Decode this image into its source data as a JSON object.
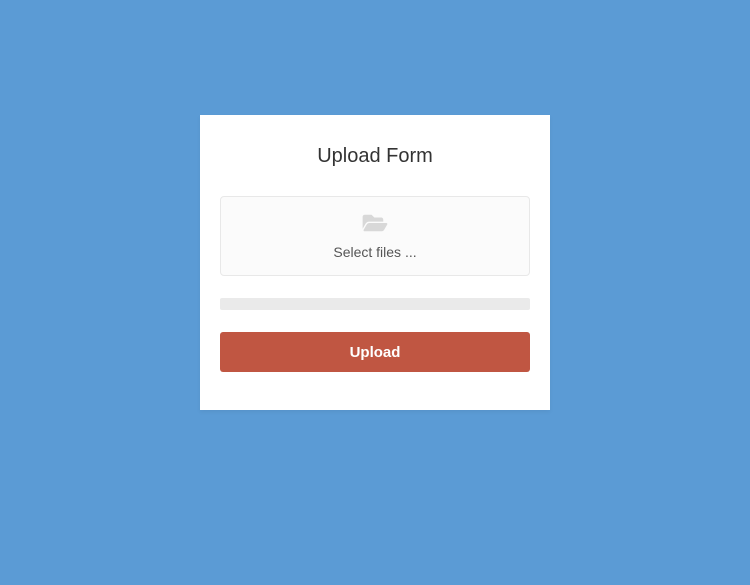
{
  "form": {
    "title": "Upload Form",
    "dropzone_text": "Select files ...",
    "upload_button_label": "Upload"
  }
}
